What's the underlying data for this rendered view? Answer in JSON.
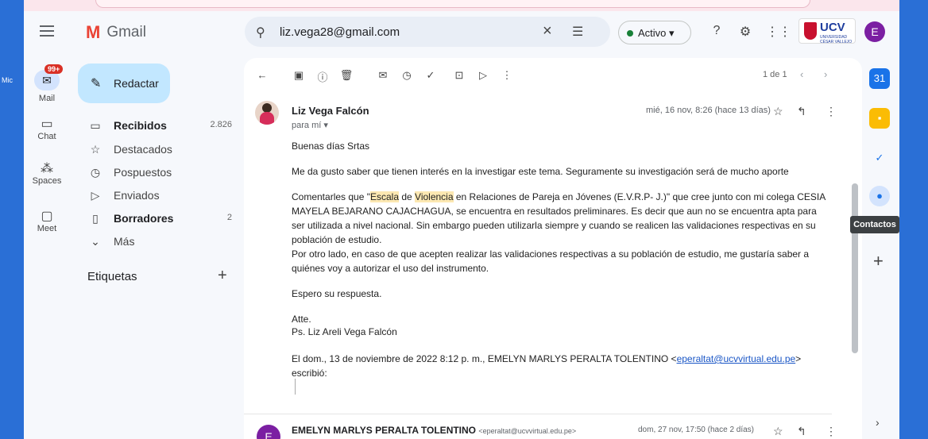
{
  "desktop": {
    "left_label": "Mic"
  },
  "header": {
    "app_name": "Gmail",
    "search_value": "liz.vega28@gmail.com",
    "status_label": "Activo ▾",
    "org_name": "UCV",
    "org_sub": "UNIVERSIDAD CÉSAR VALLEJO",
    "avatar_letter": "E"
  },
  "rail": {
    "badge": "99+",
    "items": [
      {
        "label": "Mail",
        "icon": "mail-icon"
      },
      {
        "label": "Chat",
        "icon": "chat-icon"
      },
      {
        "label": "Spaces",
        "icon": "spaces-icon"
      },
      {
        "label": "Meet",
        "icon": "meet-icon"
      }
    ]
  },
  "sidebar": {
    "compose_label": "Redactar",
    "items": [
      {
        "label": "Recibidos",
        "count": "2.826",
        "icon": "inbox-icon",
        "bold": true
      },
      {
        "label": "Destacados",
        "count": "",
        "icon": "star-icon"
      },
      {
        "label": "Pospuestos",
        "count": "",
        "icon": "clock-icon"
      },
      {
        "label": "Enviados",
        "count": "",
        "icon": "send-icon"
      },
      {
        "label": "Borradores",
        "count": "2",
        "icon": "draft-icon",
        "bold": true
      },
      {
        "label": "Más",
        "count": "",
        "icon": "chevron-down-icon"
      }
    ],
    "labels_title": "Etiquetas"
  },
  "toolbar": {
    "page_info": "1 de 1"
  },
  "message": {
    "from": "Liz Vega Falcón",
    "to": "para mí ▾",
    "date": "mié, 16 nov, 8:26 (hace 13 días)",
    "greeting": "Buenas días Srtas",
    "p1": "Me da gusto saber que tienen interés en la investigar este tema. Seguramente su investigación será de mucho aporte",
    "p2_pre": "Comentarles que \"",
    "p2_hl1": "Escala",
    "p2_mid": " de ",
    "p2_hl2": "Violencia",
    "p2_post": " en Relaciones de Pareja en Jóvenes (E.V.R.P- J.)\" que cree junto con mi colega CESIA MAYELA BEJARANO CAJACHAGUA, se encuentra en resultados preliminares. Es decir que aun no se encuentra apta para ser utilizada a nivel nacional. Sin  embargo pueden utilizarla siempre y cuando se realicen las validaciones respectivas en su población de estudio.",
    "p3": "Por otro lado, en caso de que acepten realizar las validaciones respectivas a su población de estudio, me gustaría saber a quiénes voy a autorizar el uso del instrumento.",
    "p4": "Espero su respuesta.",
    "sign1": "Atte.",
    "sign2": "Ps. Liz Areli Vega Falcón",
    "quote_pre": "El dom., 13 de noviembre de 2022 8:12 p. m., EMELYN MARLYS PERALTA TOLENTINO <",
    "quote_email": "eperaltat@ucvvirtual.edu.pe",
    "quote_post": "> escribió:"
  },
  "message2": {
    "avatar_letter": "E",
    "from": "EMELYN MARLYS PERALTA TOLENTINO",
    "email": "<eperaltat@ucvvirtual.edu.pe>",
    "date": "dom, 27 nov, 17:50 (hace 2 días)"
  },
  "side_panel": {
    "tooltip": "Contactos"
  },
  "colors": {
    "accent": "#c2e7ff",
    "highlight": "#fce8b2",
    "link": "#1a56c6"
  }
}
